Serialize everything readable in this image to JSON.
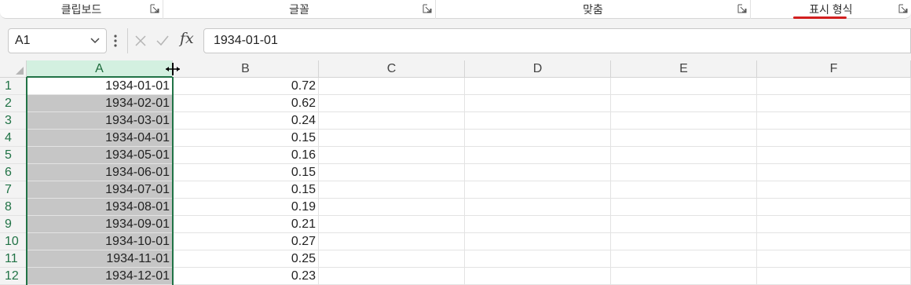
{
  "ribbon": {
    "groups": [
      {
        "label": "클립보드"
      },
      {
        "label": "글꼴"
      },
      {
        "label": "맞춤"
      },
      {
        "label": "표시 형식"
      }
    ]
  },
  "formula_bar": {
    "name_box": "A1",
    "formula": "1934-01-01",
    "fx_label": "fx"
  },
  "grid": {
    "columns": [
      "A",
      "B",
      "C",
      "D",
      "E",
      "F"
    ],
    "selected_column": "A",
    "rows": [
      {
        "n": "1",
        "a": "1934-01-01",
        "b": "0.72"
      },
      {
        "n": "2",
        "a": "1934-02-01",
        "b": "0.62"
      },
      {
        "n": "3",
        "a": "1934-03-01",
        "b": "0.24"
      },
      {
        "n": "4",
        "a": "1934-04-01",
        "b": "0.15"
      },
      {
        "n": "5",
        "a": "1934-05-01",
        "b": "0.16"
      },
      {
        "n": "6",
        "a": "1934-06-01",
        "b": "0.15"
      },
      {
        "n": "7",
        "a": "1934-07-01",
        "b": "0.15"
      },
      {
        "n": "8",
        "a": "1934-08-01",
        "b": "0.19"
      },
      {
        "n": "9",
        "a": "1934-09-01",
        "b": "0.21"
      },
      {
        "n": "10",
        "a": "1934-10-01",
        "b": "0.27"
      },
      {
        "n": "11",
        "a": "1934-11-01",
        "b": "0.25"
      },
      {
        "n": "12",
        "a": "1934-12-01",
        "b": "0.23"
      }
    ]
  },
  "colors": {
    "accent": "#217346",
    "selection_fill": "#c6c6c6",
    "header_selected": "#d3f0e0",
    "underline": "#d21f1f"
  }
}
